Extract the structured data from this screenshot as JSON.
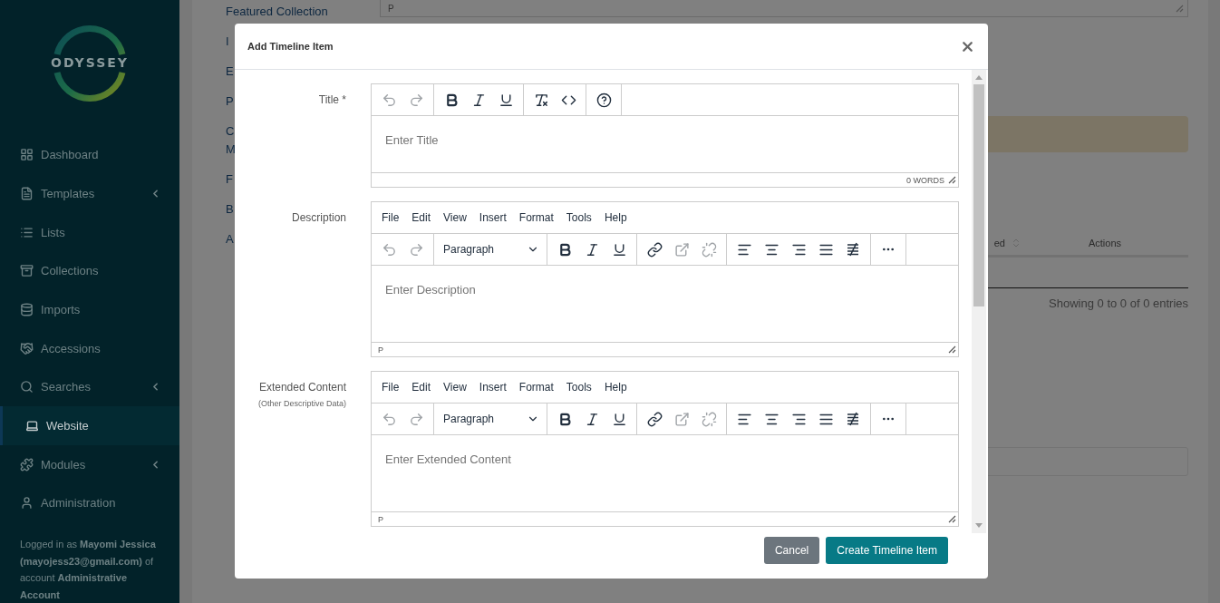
{
  "sidebar": {
    "logo": "ODYSSEY",
    "items": [
      {
        "label": "Dashboard",
        "kind": "dashboard",
        "selected": false,
        "submenu": false
      },
      {
        "label": "Templates",
        "kind": "templates",
        "selected": false,
        "submenu": true
      },
      {
        "label": "Lists",
        "kind": "lists",
        "selected": false,
        "submenu": false
      },
      {
        "label": "Collections",
        "kind": "collections",
        "selected": false,
        "submenu": false
      },
      {
        "label": "Imports",
        "kind": "imports",
        "selected": false,
        "submenu": false
      },
      {
        "label": "Accessions",
        "kind": "accessions",
        "selected": false,
        "submenu": false
      },
      {
        "label": "Searches",
        "kind": "searches",
        "selected": false,
        "submenu": true
      },
      {
        "label": "Website",
        "kind": "website",
        "selected": true,
        "submenu": false
      },
      {
        "label": "Modules",
        "kind": "modules",
        "selected": false,
        "submenu": true
      },
      {
        "label": "Administration",
        "kind": "administration",
        "selected": false,
        "submenu": false
      }
    ],
    "login": "Logged in as **Mayomi Jessica (mayojess23@gmail.com)** of account **Administrative Account**"
  },
  "background": {
    "field_labels": [
      [
        "Featured Collection"
      ],
      [
        "I"
      ],
      [
        "E"
      ],
      [
        "P"
      ],
      [
        "C",
        "M"
      ],
      [
        "F"
      ],
      [
        "B"
      ],
      [
        "A"
      ]
    ],
    "editor_status": "P",
    "table_columns": [
      "ed",
      "Actions"
    ],
    "table_info": "Showing 0 to 0 of 0 entries"
  },
  "modal": {
    "title": "Add Timeline Item",
    "fields": [
      {
        "label": "Title *",
        "toolbar": [
          [
            {
              "kind": "undo",
              "disabled": true
            },
            {
              "kind": "redo",
              "disabled": true
            }
          ],
          [
            {
              "kind": "bold",
              "disabled": false
            },
            {
              "kind": "italic",
              "disabled": false
            },
            {
              "kind": "underline",
              "disabled": false
            }
          ],
          [
            {
              "kind": "clear-format",
              "disabled": false
            },
            {
              "kind": "code",
              "disabled": false
            }
          ],
          [
            {
              "kind": "help",
              "disabled": false
            }
          ]
        ],
        "placeholder": "Enter Title",
        "status": "0 WORDS"
      },
      {
        "label": "Description",
        "menubar": [
          "File",
          "Edit",
          "View",
          "Insert",
          "Format",
          "Tools",
          "Help"
        ],
        "toolbar": [
          [
            {
              "kind": "undo",
              "disabled": true
            },
            {
              "kind": "redo",
              "disabled": true
            }
          ],
          [
            {
              "kind": "format-select",
              "label": "Paragraph"
            }
          ],
          [
            {
              "kind": "bold",
              "disabled": false
            },
            {
              "kind": "italic",
              "disabled": false
            },
            {
              "kind": "underline",
              "disabled": false
            }
          ],
          [
            {
              "kind": "link",
              "disabled": false
            },
            {
              "kind": "open-link",
              "disabled": true
            },
            {
              "kind": "unlink",
              "disabled": true
            }
          ],
          [
            {
              "kind": "align-left",
              "disabled": false
            },
            {
              "kind": "align-center",
              "disabled": false
            },
            {
              "kind": "align-right",
              "disabled": false
            },
            {
              "kind": "justify",
              "disabled": false
            },
            {
              "kind": "lines-slash",
              "disabled": false
            }
          ],
          [
            {
              "kind": "more",
              "disabled": false
            }
          ]
        ],
        "placeholder": "Enter Description",
        "status": "P"
      },
      {
        "label": "Extended Content",
        "note": "(Other Descriptive Data)",
        "menubar": [
          "File",
          "Edit",
          "View",
          "Insert",
          "Format",
          "Tools",
          "Help"
        ],
        "toolbar": [
          [
            {
              "kind": "undo",
              "disabled": true
            },
            {
              "kind": "redo",
              "disabled": true
            }
          ],
          [
            {
              "kind": "format-select",
              "label": "Paragraph"
            }
          ],
          [
            {
              "kind": "bold",
              "disabled": false
            },
            {
              "kind": "italic",
              "disabled": false
            },
            {
              "kind": "underline",
              "disabled": false
            }
          ],
          [
            {
              "kind": "link",
              "disabled": false
            },
            {
              "kind": "open-link",
              "disabled": true
            },
            {
              "kind": "unlink",
              "disabled": true
            }
          ],
          [
            {
              "kind": "align-left",
              "disabled": false
            },
            {
              "kind": "align-center",
              "disabled": false
            },
            {
              "kind": "align-right",
              "disabled": false
            },
            {
              "kind": "justify",
              "disabled": false
            },
            {
              "kind": "lines-slash",
              "disabled": false
            }
          ],
          [
            {
              "kind": "more",
              "disabled": false
            }
          ]
        ],
        "placeholder": "Enter Extended Content",
        "status": "P"
      }
    ],
    "buttons": [
      {
        "label": "Cancel",
        "kind": "secondary"
      },
      {
        "label": "Create Timeline Item",
        "kind": "primary"
      }
    ]
  }
}
